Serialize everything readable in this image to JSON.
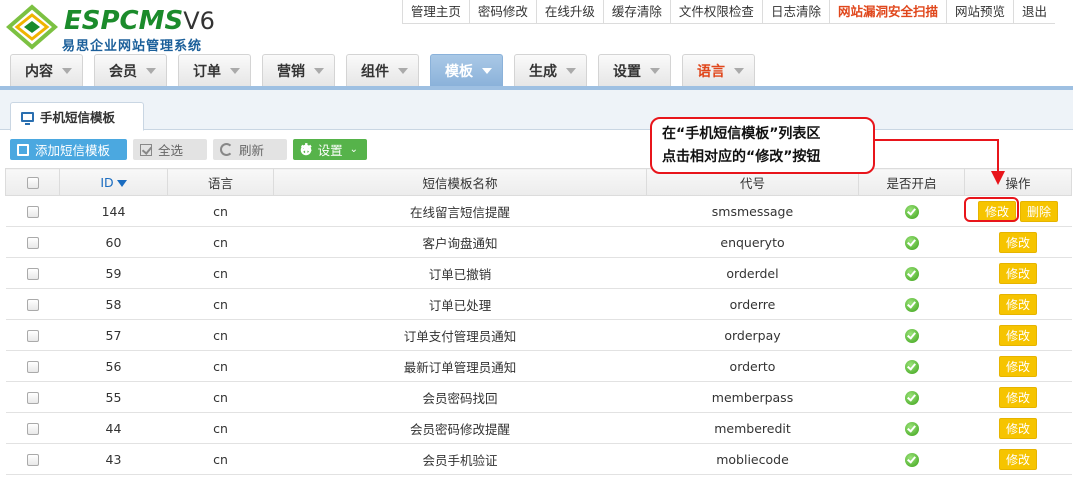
{
  "logo": {
    "title": "ESPCMS",
    "version": "V6",
    "subtitle": "易思企业网站管理系统"
  },
  "top_nav": [
    {
      "label": "管理主页",
      "name": "top-link-home"
    },
    {
      "label": "密码修改",
      "name": "top-link-password"
    },
    {
      "label": "在线升级",
      "name": "top-link-upgrade"
    },
    {
      "label": "缓存清除",
      "name": "top-link-cache"
    },
    {
      "label": "文件权限检查",
      "name": "top-link-permissions"
    },
    {
      "label": "日志清除",
      "name": "top-link-logs"
    },
    {
      "label": "网站漏洞安全扫描",
      "name": "top-link-security-scan",
      "highlight": true
    },
    {
      "label": "网站预览",
      "name": "top-link-preview"
    },
    {
      "label": "退出",
      "name": "top-link-logout"
    }
  ],
  "main_nav": [
    {
      "label": "内容",
      "name": "nav-content"
    },
    {
      "label": "会员",
      "name": "nav-member"
    },
    {
      "label": "订单",
      "name": "nav-order"
    },
    {
      "label": "营销",
      "name": "nav-marketing"
    },
    {
      "label": "组件",
      "name": "nav-component"
    },
    {
      "label": "模板",
      "name": "nav-template",
      "active": true
    },
    {
      "label": "生成",
      "name": "nav-generate"
    },
    {
      "label": "设置",
      "name": "nav-settings"
    },
    {
      "label": "语言",
      "name": "nav-language",
      "lang": true
    }
  ],
  "sub_tab": {
    "label": "手机短信模板"
  },
  "toolbar": {
    "add_label": "添加短信模板",
    "select_all_label": "全选",
    "refresh_label": "刷新",
    "settings_label": "设置"
  },
  "table": {
    "headers": {
      "id": "ID",
      "lang": "语言",
      "name": "短信模板名称",
      "code": "代号",
      "enabled": "是否开启",
      "actions": "操作"
    },
    "edit_label": "修改",
    "delete_label": "删除",
    "rows": [
      {
        "id": "144",
        "lang": "cn",
        "name": "在线留言短信提醒",
        "code": "smsmessage",
        "deletable": true
      },
      {
        "id": "60",
        "lang": "cn",
        "name": "客户询盘通知",
        "code": "enqueryto"
      },
      {
        "id": "59",
        "lang": "cn",
        "name": "订单已撤销",
        "code": "orderdel"
      },
      {
        "id": "58",
        "lang": "cn",
        "name": "订单已处理",
        "code": "orderre"
      },
      {
        "id": "57",
        "lang": "cn",
        "name": "订单支付管理员通知",
        "code": "orderpay"
      },
      {
        "id": "56",
        "lang": "cn",
        "name": "最新订单管理员通知",
        "code": "orderto"
      },
      {
        "id": "55",
        "lang": "cn",
        "name": "会员密码找回",
        "code": "memberpass"
      },
      {
        "id": "44",
        "lang": "cn",
        "name": "会员密码修改提醒",
        "code": "memberedit"
      },
      {
        "id": "43",
        "lang": "cn",
        "name": "会员手机验证",
        "code": "mobliecode"
      }
    ]
  },
  "annotation": {
    "line1": "在“手机短信模板”列表区",
    "line2": "点击相对应的“修改”按钮",
    "color": "#e8151b"
  }
}
